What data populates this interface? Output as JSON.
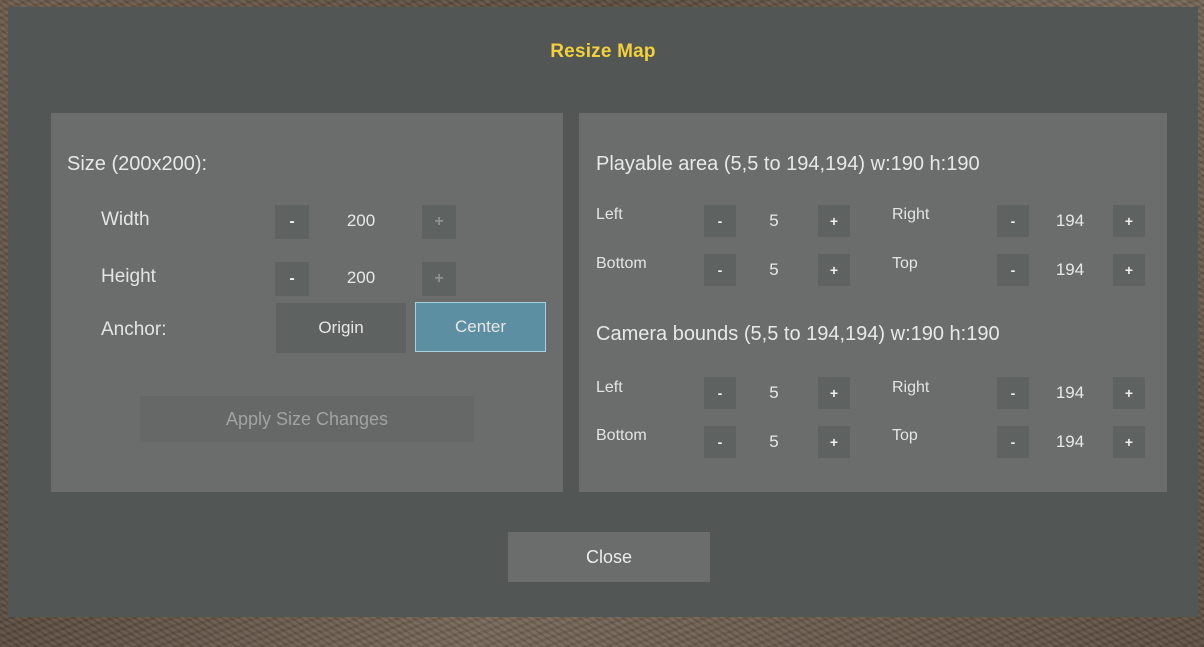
{
  "dialog": {
    "title": "Resize Map",
    "close_label": "Close"
  },
  "size_panel": {
    "heading": "Size (200x200):",
    "width": {
      "label": "Width",
      "value": "200",
      "dec": "-",
      "inc": "+"
    },
    "height": {
      "label": "Height",
      "value": "200",
      "dec": "-",
      "inc": "+"
    },
    "anchor": {
      "label": "Anchor:",
      "options": [
        "Origin",
        "Center"
      ],
      "selected": "Center"
    },
    "apply_label": "Apply Size Changes",
    "apply_enabled": false
  },
  "bounds_panel": {
    "playable": {
      "heading": "Playable area (5,5 to 194,194) w:190 h:190",
      "left": {
        "label": "Left",
        "value": "5"
      },
      "right": {
        "label": "Right",
        "value": "194"
      },
      "bottom": {
        "label": "Bottom",
        "value": "5"
      },
      "top": {
        "label": "Top",
        "value": "194"
      }
    },
    "camera": {
      "heading": "Camera bounds (5,5 to 194,194) w:190 h:190",
      "left": {
        "label": "Left",
        "value": "5"
      },
      "right": {
        "label": "Right",
        "value": "194"
      },
      "bottom": {
        "label": "Bottom",
        "value": "5"
      },
      "top": {
        "label": "Top",
        "value": "194"
      }
    },
    "dec": "-",
    "inc": "+"
  },
  "colors": {
    "title": "#f2d13a",
    "dialog_bg": "#525654",
    "panel_bg": "#6a6d6b",
    "selected_accent": "#5d8fa2"
  }
}
